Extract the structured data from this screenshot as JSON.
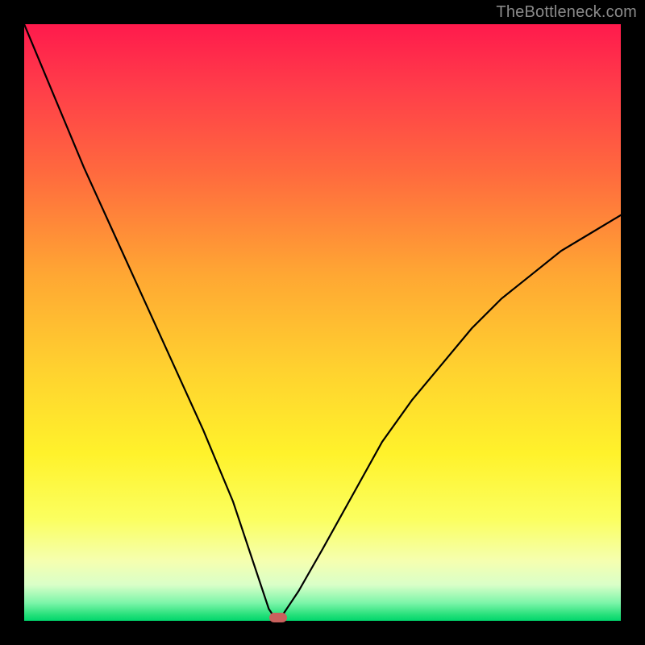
{
  "watermark": "TheBottleneck.com",
  "chart_data": {
    "type": "line",
    "title": "",
    "xlabel": "",
    "ylabel": "",
    "xlim": [
      0,
      100
    ],
    "ylim": [
      0,
      100
    ],
    "grid": false,
    "legend": false,
    "background": "red-yellow-green vertical gradient",
    "x": [
      0,
      5,
      10,
      15,
      20,
      25,
      30,
      35,
      38,
      40,
      41,
      42,
      42.5,
      43,
      44,
      46,
      50,
      55,
      60,
      65,
      70,
      75,
      80,
      85,
      90,
      95,
      100
    ],
    "y": [
      100,
      88,
      76,
      65,
      54,
      43,
      32,
      20,
      11,
      5,
      2,
      0.5,
      0,
      0.5,
      2,
      5,
      12,
      21,
      30,
      37,
      43,
      49,
      54,
      58,
      62,
      65,
      68
    ],
    "marker_points": [
      {
        "x": 42.5,
        "y": 0.5,
        "color": "#c9615d",
        "shape": "pill"
      }
    ],
    "gradient_stops": [
      {
        "pos": 0.0,
        "color": "#ff1a4c"
      },
      {
        "pos": 0.1,
        "color": "#ff3b4a"
      },
      {
        "pos": 0.25,
        "color": "#ff6a3e"
      },
      {
        "pos": 0.42,
        "color": "#ffa733"
      },
      {
        "pos": 0.58,
        "color": "#ffd22f"
      },
      {
        "pos": 0.72,
        "color": "#fff22b"
      },
      {
        "pos": 0.83,
        "color": "#fbff60"
      },
      {
        "pos": 0.9,
        "color": "#f5ffb0"
      },
      {
        "pos": 0.94,
        "color": "#d9ffc8"
      },
      {
        "pos": 0.97,
        "color": "#7cf5a9"
      },
      {
        "pos": 0.99,
        "color": "#26e07a"
      },
      {
        "pos": 1.0,
        "color": "#00d66c"
      }
    ]
  }
}
